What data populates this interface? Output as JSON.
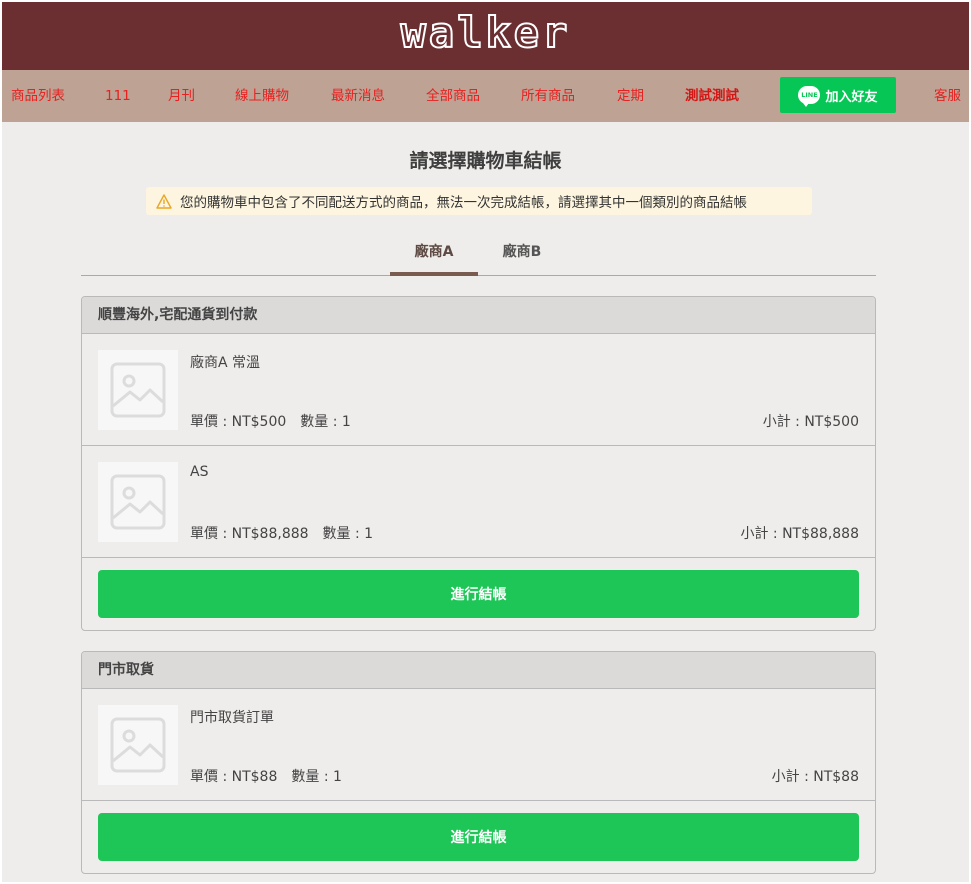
{
  "header": {
    "logo": "walker"
  },
  "nav": {
    "items": [
      "商品列表",
      "111",
      "月刊",
      "線上購物",
      "最新消息",
      "全部商品",
      "所有商品",
      "定期",
      "測試測試",
      "客服"
    ],
    "line_button": {
      "icon_text": "LINE",
      "label": "加入好友"
    }
  },
  "page": {
    "title": "請選擇購物車結帳",
    "warning": "您的購物車中包含了不同配送方式的商品，無法一次完成結帳，請選擇其中一個類別的商品結帳",
    "tabs": [
      "廠商A",
      "廠商B"
    ]
  },
  "groups": [
    {
      "title": "順豐海外,宅配通貨到付款",
      "items": [
        {
          "name": "廠商A 常溫",
          "price": "單價 : NT$500",
          "qty": "數量 : 1",
          "subtotal": "小計 : NT$500"
        },
        {
          "name": "AS",
          "price": "單價 : NT$88,888",
          "qty": "數量 : 1",
          "subtotal": "小計 : NT$88,888"
        }
      ],
      "checkout_label": "進行結帳"
    },
    {
      "title": "門市取貨",
      "items": [
        {
          "name": "門市取貨訂單",
          "price": "單價 : NT$88",
          "qty": "數量 : 1",
          "subtotal": "小計 : NT$88"
        }
      ],
      "checkout_label": "進行結帳"
    }
  ],
  "colors": {
    "header_bg": "#6b2f32",
    "nav_bg": "#bea394",
    "nav_text": "#e82020",
    "line_green": "#06c755",
    "checkout_green": "#1dc657",
    "tab_active": "#7a5b50"
  }
}
